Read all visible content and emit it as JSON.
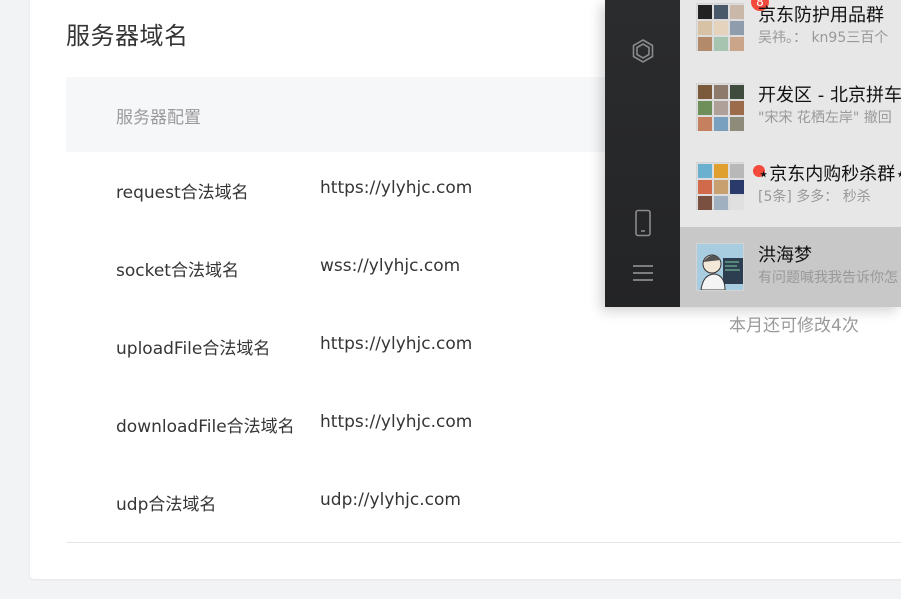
{
  "section": {
    "title": "服务器域名"
  },
  "table": {
    "header": "服务器配置",
    "rows": [
      {
        "key": "request合法域名",
        "value": "https://ylyhjc.com"
      },
      {
        "key": "socket合法域名",
        "value": "wss://ylyhjc.com"
      },
      {
        "key": "uploadFile合法域名",
        "value": "https://ylyhjc.com"
      },
      {
        "key": "downloadFile合法域名",
        "value": "https://ylyhjc.com"
      },
      {
        "key": "udp合法域名",
        "value": "udp://ylyhjc.com"
      }
    ]
  },
  "quota_text": "本月还可修改4次",
  "chat": {
    "rail_icons": [
      "mini-program-icon",
      "phone-icon",
      "menu-icon"
    ],
    "items": [
      {
        "name": "京东防护用品群",
        "preview": "吴祎。： kn95三百个",
        "badge": "8"
      },
      {
        "name": "开发区 - 北京拼车",
        "preview": "\"宋宋 花栖左岸\" 撤回"
      },
      {
        "name": "⋆京东内购秒杀群⋆",
        "preview": "[5条] 多多：  秒杀"
      },
      {
        "name": "洪海梦",
        "preview": "有问题喊我我告诉你怎"
      }
    ]
  },
  "colors": {
    "accent_badge": "#f34a3c",
    "rail_bg": "#2b2c2e",
    "list_bg": "#e7e7e7",
    "selected_bg": "#c8c8c8"
  }
}
